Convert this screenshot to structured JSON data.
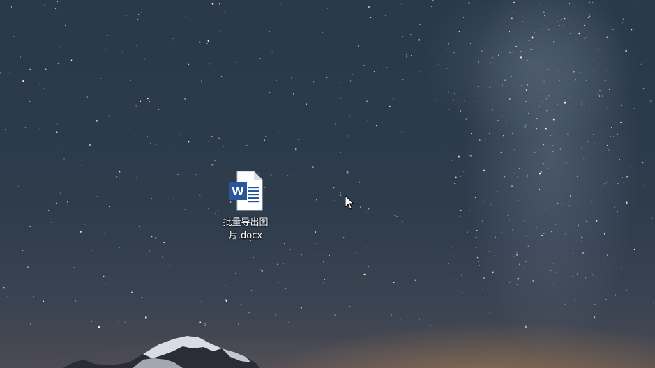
{
  "desktop": {
    "wallpaper": "starry-night-sky-with-milky-way",
    "icons": [
      {
        "type": "word-document-icon",
        "name_line1": "批量导出图",
        "name_line2": "片.docx",
        "accent_color": "#2b579a"
      }
    ]
  },
  "cursor": {
    "type": "arrow-pointer"
  }
}
